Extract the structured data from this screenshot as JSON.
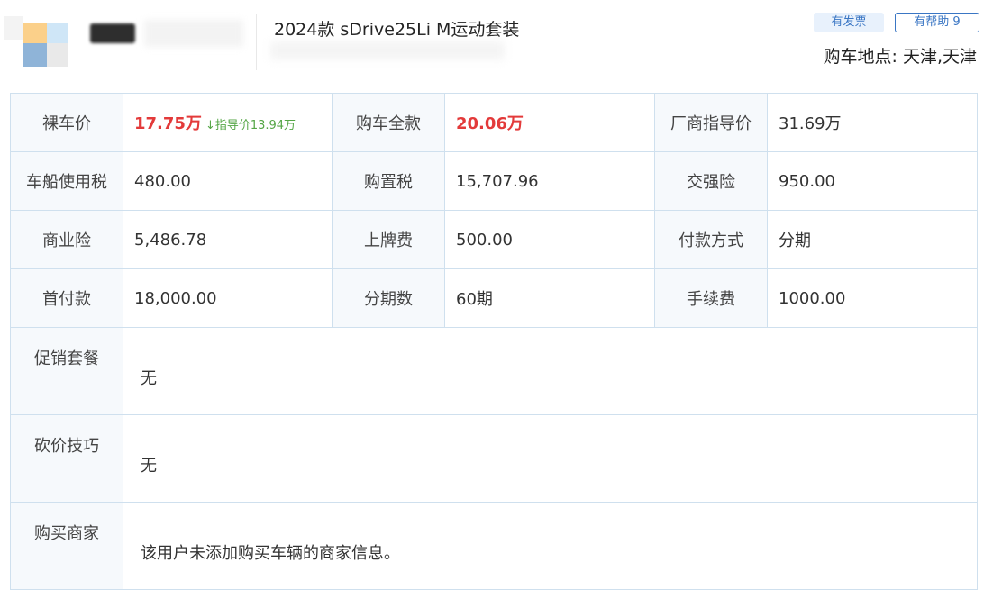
{
  "header": {
    "title": "2024款 sDrive25Li M运动套装",
    "invoice_badge": "有发票",
    "helpful_button": "有帮助 9",
    "location": "购车地点: 天津,天津"
  },
  "details": {
    "bare_price_label": "裸车价",
    "bare_price": "17.75万",
    "bare_price_arrow": "↓",
    "guide_diff": "指导价13.94万",
    "full_price_label": "购车全款",
    "full_price": "20.06万",
    "msrp_label": "厂商指导价",
    "msrp": "31.69万",
    "vessel_tax_label": "车船使用税",
    "vessel_tax": "480.00",
    "purchase_tax_label": "购置税",
    "purchase_tax": "15,707.96",
    "compulsory_ins_label": "交强险",
    "compulsory_ins": "950.00",
    "commercial_ins_label": "商业险",
    "commercial_ins": "5,486.78",
    "plate_fee_label": "上牌费",
    "plate_fee": "500.00",
    "payment_method_label": "付款方式",
    "payment_method": "分期",
    "down_payment_label": "首付款",
    "down_payment": "18,000.00",
    "installments_label": "分期数",
    "installments": "60期",
    "handling_fee_label": "手续费",
    "handling_fee": "1000.00",
    "promotion_label": "促销套餐",
    "promotion": "无",
    "bargain_label": "砍价技巧",
    "bargain": "无",
    "dealer_label": "购买商家",
    "dealer": "该用户未添加购买车辆的商家信息。"
  },
  "colors": {
    "price_red": "#e33a3a",
    "guide_green": "#55a646",
    "accent_blue": "#3a76c4",
    "border": "#cfe0ee"
  }
}
